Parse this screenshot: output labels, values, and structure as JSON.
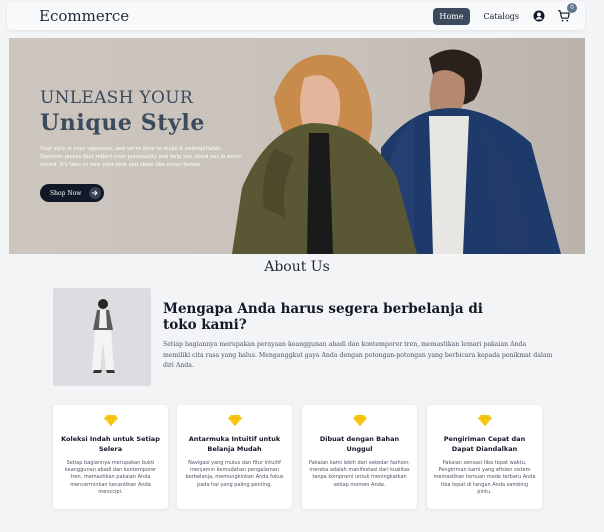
{
  "navbar": {
    "brand": "Ecommerce",
    "home_label": "Home",
    "catalogs_label": "Catalogs",
    "cart_count": "0",
    "user_icon": "user-circle-icon",
    "cart_icon": "shopping-cart-icon"
  },
  "hero": {
    "line1": "UNLEASH YOUR",
    "line2": "Unique Style",
    "description": "Your style is your signature, and we're here to make it unforgettable. Discover pieces that reflect your personality and help you stand out in every crowd. It's time to own your look and shine like never before.",
    "button_label": "Shop Now"
  },
  "about": {
    "title": "About Us",
    "why_title": "Mengapa Anda harus segera berbelanja di toko kami?",
    "why_desc": "Setiap bagiannya merupakan perayaan keanggunan abadi dan kontemporer tren, memastikan lemari pakaian Anda memiliki cita rasa yang halus. Menganggkut gaya Anda dengan potongan-potongan yang berbicara kepada penikmat dalam diri Anda."
  },
  "features": [
    {
      "title": "Koleksi Indah untuk Setiap Selera",
      "desc": "Setiap bagiannya merupakan bukti keanggunan abadi dan kontemporer tren, memastikan pakaian Anda mencerminkan kecantikan Anda menccipi."
    },
    {
      "title": "Antarmuka Intuitif untuk Belanja Mudah",
      "desc": "Navigasi yang mulus dan fitur intuitif menjamin kemudahan pengalaman berbelanja, memungkinkan Anda fokus pada hal yang paling penting."
    },
    {
      "title": "Dibuat dengan Bahan Unggul",
      "desc": "Pakaian kami lebih dari sekedar fashion; mereka adalah manifestasi dari kualitas tanpa kompromi untuk meningkatkan setiap momen Anda."
    },
    {
      "title": "Pengiriman Cepat dan Dapat Diandalkan",
      "desc": "Pakaian sensasi tiba tepat waktu. Pengiriman kami yang efisien sistem memastikan temuan mode terbaru Anda tiba tepat di tangan Anda sambing pintu."
    }
  ],
  "colors": {
    "accent": "#3b4a5c",
    "gem": "#facc15"
  }
}
